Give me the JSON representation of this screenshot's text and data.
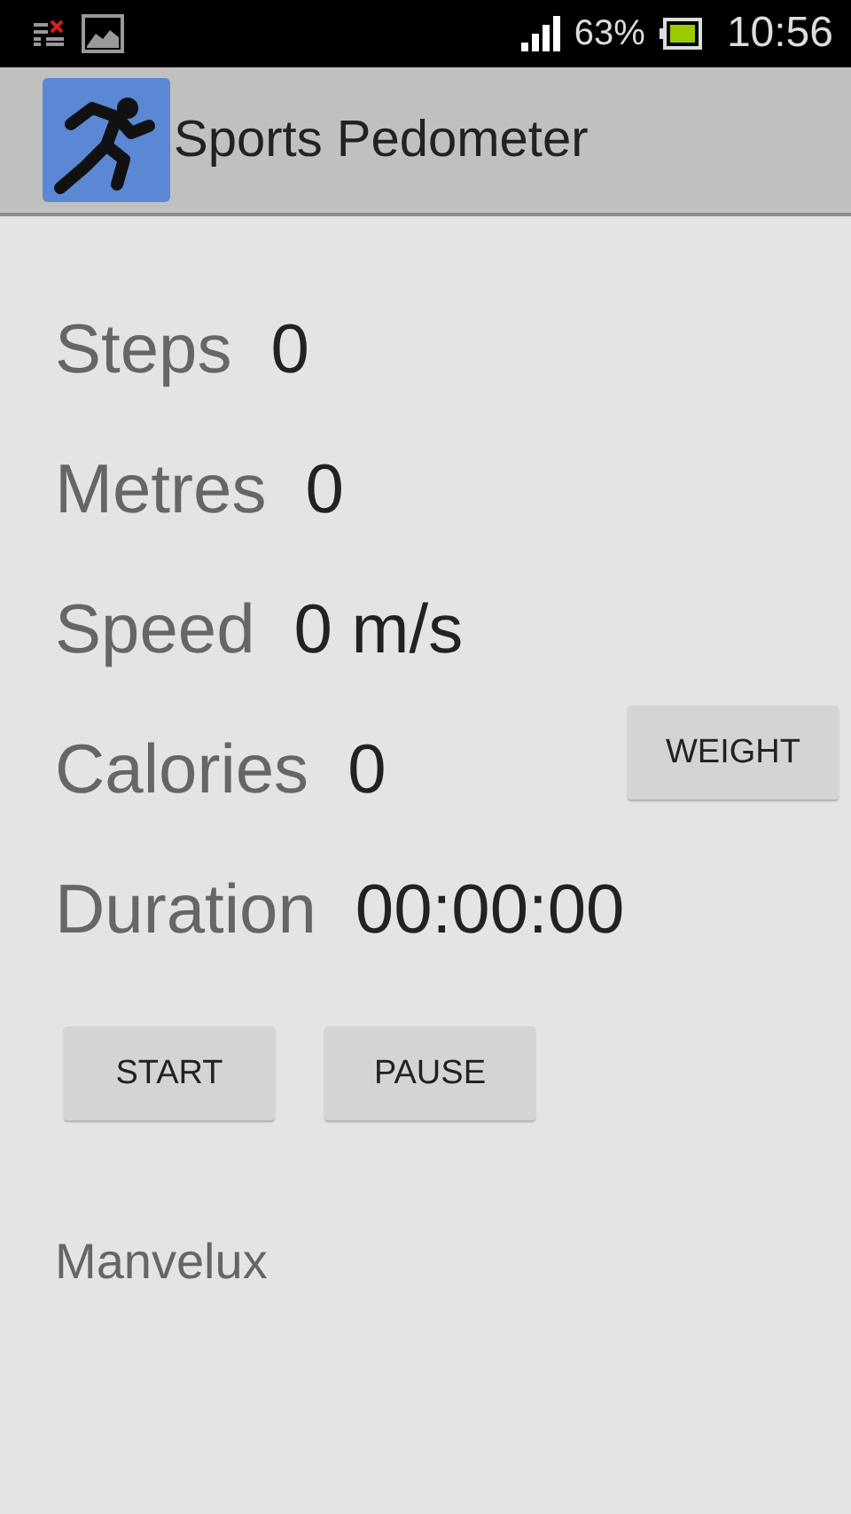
{
  "status_bar": {
    "battery": "63%",
    "time": "10:56"
  },
  "app_bar": {
    "title": "Sports Pedometer"
  },
  "stats": [
    {
      "label": "Steps",
      "value": "0"
    },
    {
      "label": "Metres",
      "value": "0"
    },
    {
      "label": "Speed",
      "value": "0 m/s"
    },
    {
      "label": "Calories",
      "value": "0",
      "action": "WEIGHT"
    },
    {
      "label": "Duration",
      "value": "00:00:00"
    }
  ],
  "buttons": [
    "START",
    "PAUSE"
  ],
  "footer": "Manvelux"
}
